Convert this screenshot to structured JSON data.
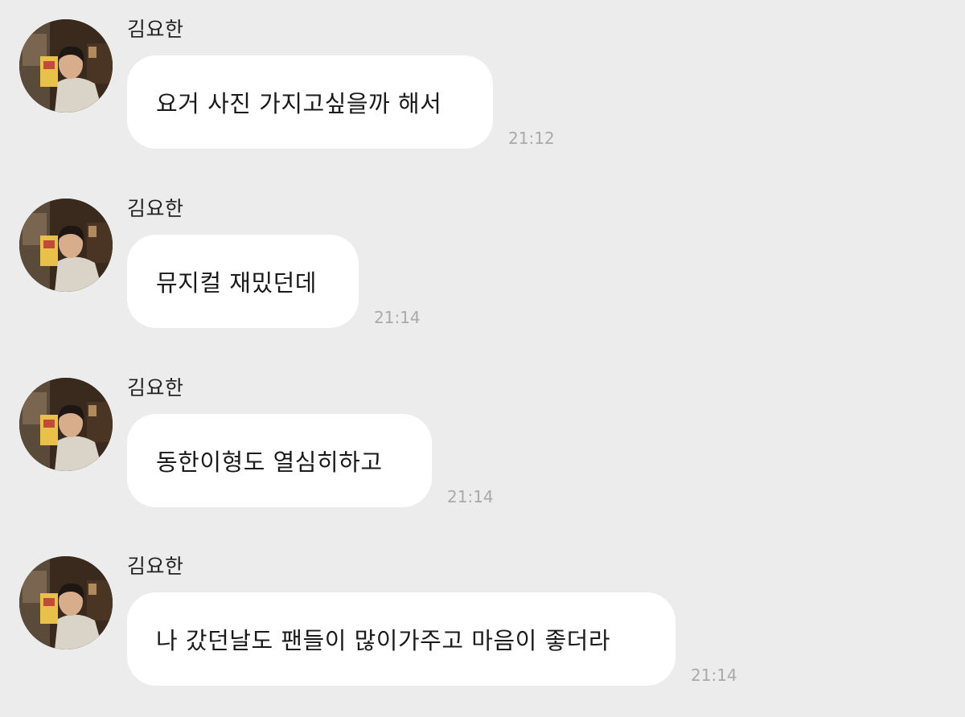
{
  "messages": [
    {
      "sender": "김요한",
      "text": "요거 사진 가지고싶을까 해서",
      "time": "21:12"
    },
    {
      "sender": "김요한",
      "text": "뮤지컬 재밌던데",
      "time": "21:14"
    },
    {
      "sender": "김요한",
      "text": "동한이형도 열심히하고",
      "time": "21:14"
    },
    {
      "sender": "김요한",
      "text": "나 갔던날도 팬들이 많이가주고 마음이 좋더라",
      "time": "21:14"
    }
  ],
  "colors": {
    "background": "#ececec",
    "bubble": "#ffffff",
    "timestamp": "#a9a9a9"
  }
}
